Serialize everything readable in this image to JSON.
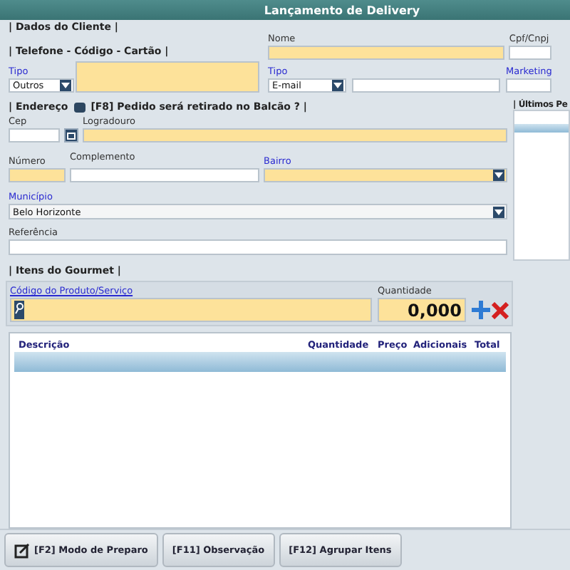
{
  "window": {
    "title": "Lançamento de Delivery"
  },
  "cliente": {
    "heading": "| Dados do Cliente |",
    "phone_heading": "| Telefone - Código - Cartão |",
    "tipo_label": "Tipo",
    "tipo_value": "Outros",
    "nome_label": "Nome",
    "cpf_label": "Cpf/Cnpj",
    "contato_tipo_label": "Tipo",
    "contato_tipo_value": "E-mail",
    "marketing_label": "Marketing"
  },
  "endereco": {
    "heading": "| Endereço",
    "balcao_label": "[F8] Pedido será retirado no Balcão ? |",
    "balcao_checked": true,
    "cep_label": "Cep",
    "logradouro_label": "Logradouro",
    "numero_label": "Número",
    "complemento_label": "Complemento",
    "bairro_label": "Bairro",
    "municipio_label": "Município",
    "municipio_value": "Belo Horizonte",
    "referencia_label": "Referência"
  },
  "ultimos": {
    "heading": "| Últimos Pe"
  },
  "itens": {
    "heading": "| Itens do Gourmet |",
    "codigo_label": "Código do Produto/Serviço",
    "quantidade_label": "Quantidade",
    "quantidade_value": "0,000",
    "columns": [
      "Descrição",
      "Quantidade",
      "Preço",
      "Adicionais",
      "Total"
    ]
  },
  "buttons": [
    {
      "label": "[F2] Modo de Preparo",
      "icon": true
    },
    {
      "label": "[F11] Observação",
      "icon": false
    },
    {
      "label": "[F12] Agrupar Itens",
      "icon": false
    }
  ]
}
